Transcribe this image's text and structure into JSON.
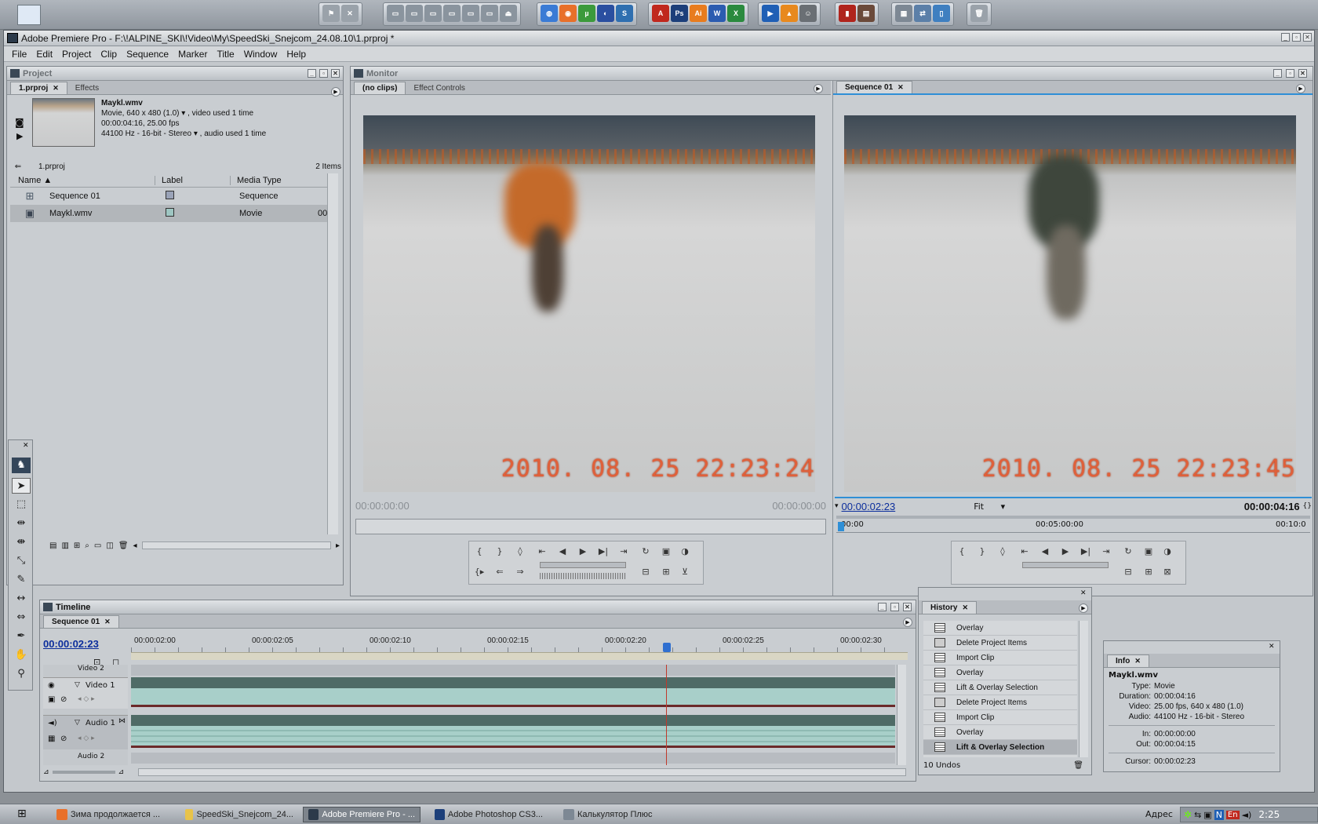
{
  "app": {
    "title": "Adobe Premiere Pro - F:\\!ALPINE_SKI\\!Video\\My\\SpeedSki_Snejcom_24.08.10\\1.prproj *",
    "menu": [
      "File",
      "Edit",
      "Project",
      "Clip",
      "Sequence",
      "Marker",
      "Title",
      "Window",
      "Help"
    ]
  },
  "project": {
    "panel_title": "Project",
    "tabs": [
      "1.prproj",
      "Effects"
    ],
    "preview": {
      "name": "Maykl.wmv",
      "line1": "Movie, 640 x 480 (1.0)",
      "line1b": ", video used 1 time",
      "line2": "00:00:04:16, 25.00 fps",
      "line3": "44100 Hz - 16-bit - Stereo",
      "line3b": ", audio used 1 time"
    },
    "bin": "1.prproj",
    "item_count": "2 Items",
    "columns": [
      "Name",
      "Label",
      "Media Type"
    ],
    "rows": [
      {
        "name": "Sequence 01",
        "type": "Sequence",
        "extra": ""
      },
      {
        "name": "Maykl.wmv",
        "type": "Movie",
        "extra": "00"
      }
    ]
  },
  "monitor": {
    "panel_title": "Monitor",
    "source": {
      "tabs": [
        "(no clips)",
        "Effect Controls"
      ],
      "timecode_left": "00:00:00:00",
      "timecode_right": "00:00:00:00",
      "stamp": "2010. 08. 25  22:23:24"
    },
    "program": {
      "tab": "Sequence 01",
      "timecode_current": "00:00:02:23",
      "zoom": "Fit",
      "duration": "00:00:04:16",
      "ruler": [
        "00:00",
        "00:05:00:00",
        "00:10:0"
      ],
      "stamp": "2010. 08. 25  22:23:45"
    }
  },
  "timeline": {
    "panel_title": "Timeline",
    "tab": "Sequence 01",
    "current_time": "00:00:02:23",
    "ruler": [
      "00:00:02:00",
      "00:00:02:05",
      "00:00:02:10",
      "00:00:02:15",
      "00:00:02:20",
      "00:00:02:25",
      "00:00:02:30"
    ],
    "tracks": {
      "video2": "Video 2",
      "video1": "Video 1",
      "audio1": "Audio 1",
      "audio2": "Audio 2"
    }
  },
  "history": {
    "title": "History",
    "items": [
      "Overlay",
      "Delete Project Items",
      "Import Clip",
      "Overlay",
      "Lift & Overlay Selection",
      "Delete Project Items",
      "Import Clip",
      "Overlay",
      "Lift & Overlay Selection"
    ],
    "undos": "10 Undos"
  },
  "info": {
    "title": "Info",
    "name": "Maykl.wmv",
    "rows": [
      {
        "k": "Type:",
        "v": "Movie"
      },
      {
        "k": "Duration:",
        "v": "00:00:04:16"
      },
      {
        "k": "Video:",
        "v": "25.00 fps, 640 x 480 (1.0)"
      },
      {
        "k": "Audio:",
        "v": "44100 Hz - 16-bit - Stereo"
      }
    ],
    "in_k": "In:",
    "in_v": "00:00:00:00",
    "out_k": "Out:",
    "out_v": "00:00:04:15",
    "cursor_k": "Cursor:",
    "cursor_v": "00:00:02:23"
  },
  "taskbar": {
    "tasks": [
      "Зима продолжается ...",
      "SpeedSki_Snejcom_24...",
      "Adobe Premiere Pro - ...",
      "Adobe Photoshop CS3...",
      "Калькулятор Плюс"
    ],
    "address_label": "Адрес",
    "lang": "En",
    "clock": "2:25"
  },
  "colors": {
    "accent_timecode": "#0b2d9c",
    "playhead": "#c0392b",
    "track_video": "#4f6b66",
    "track_clip": "#a8cfc9"
  }
}
